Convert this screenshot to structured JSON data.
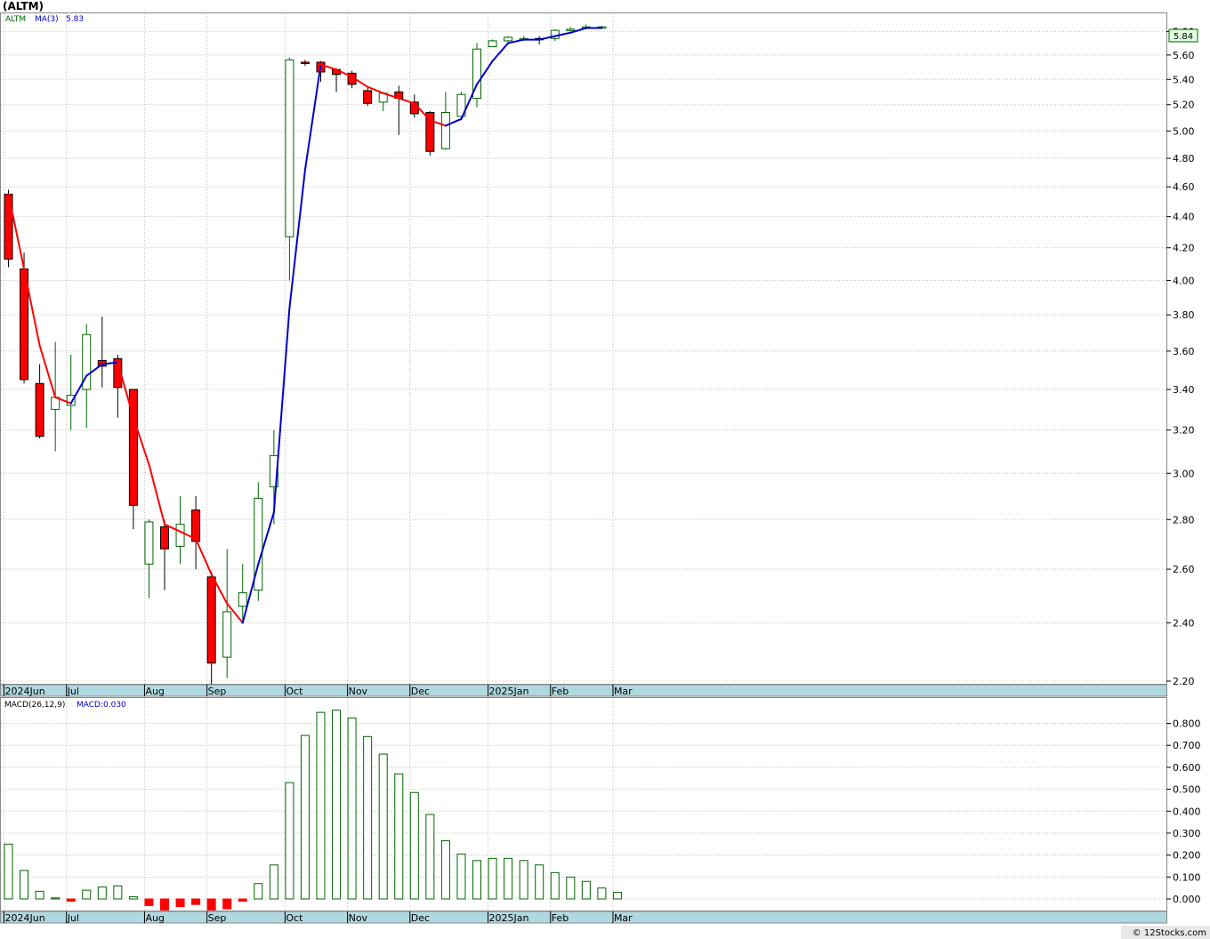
{
  "header": {
    "symbol_title": "(ALTM)",
    "price_legend_symbol": "ALTM",
    "ma_label": "MA(3)",
    "ma_value": "5.83",
    "last_price_tag": "5.84"
  },
  "macd_panel": {
    "params_label": "MACD(26,12,9)",
    "value_label": "MACD:0.030"
  },
  "footer": {
    "watermark": "© 12Stocks.com"
  },
  "colors": {
    "up_candle_outline": "#006400",
    "down_candle_fill": "#ff0000",
    "ma_rising": "#0000cc",
    "ma_falling": "#ff0000",
    "axis_band": "#b0d8e0",
    "grid": "#c0c0c0"
  },
  "chart_data": [
    {
      "type": "candlestick",
      "timeframe": "weekly",
      "y_axis_scale": "log",
      "y_ticks": [
        "2.20",
        "2.40",
        "2.60",
        "2.80",
        "3.00",
        "3.20",
        "3.40",
        "3.60",
        "3.80",
        "4.00",
        "4.20",
        "4.40",
        "4.60",
        "4.80",
        "5.00",
        "5.20",
        "5.40",
        "5.60",
        "5.80"
      ],
      "x_tick_labels": [
        {
          "index": 0,
          "label": "2024Jun"
        },
        {
          "index": 4,
          "label": "Jul"
        },
        {
          "index": 9,
          "label": "Aug"
        },
        {
          "index": 13,
          "label": "Sep"
        },
        {
          "index": 18,
          "label": "Oct"
        },
        {
          "index": 22,
          "label": "Nov"
        },
        {
          "index": 26,
          "label": "Dec"
        },
        {
          "index": 31,
          "label": "2025Jan"
        },
        {
          "index": 35,
          "label": "Feb"
        },
        {
          "index": 39,
          "label": "Mar"
        }
      ],
      "candles": [
        {
          "o": 4.55,
          "h": 4.58,
          "l": 4.08,
          "c": 4.13
        },
        {
          "o": 4.07,
          "h": 4.17,
          "l": 3.43,
          "c": 3.45
        },
        {
          "o": 3.43,
          "h": 3.53,
          "l": 3.16,
          "c": 3.17
        },
        {
          "o": 3.3,
          "h": 3.65,
          "l": 3.1,
          "c": 3.36
        },
        {
          "o": 3.32,
          "h": 3.58,
          "l": 3.2,
          "c": 3.37
        },
        {
          "o": 3.4,
          "h": 3.75,
          "l": 3.21,
          "c": 3.69
        },
        {
          "o": 3.55,
          "h": 3.79,
          "l": 3.41,
          "c": 3.52
        },
        {
          "o": 3.56,
          "h": 3.58,
          "l": 3.26,
          "c": 3.41
        },
        {
          "o": 3.4,
          "h": 3.4,
          "l": 2.76,
          "c": 2.86
        },
        {
          "o": 2.62,
          "h": 2.8,
          "l": 2.49,
          "c": 2.79
        },
        {
          "o": 2.77,
          "h": 2.8,
          "l": 2.52,
          "c": 2.68
        },
        {
          "o": 2.69,
          "h": 2.9,
          "l": 2.62,
          "c": 2.78
        },
        {
          "o": 2.84,
          "h": 2.9,
          "l": 2.6,
          "c": 2.71
        },
        {
          "o": 2.57,
          "h": 2.59,
          "l": 2.19,
          "c": 2.26
        },
        {
          "o": 2.28,
          "h": 2.68,
          "l": 2.21,
          "c": 2.44
        },
        {
          "o": 2.46,
          "h": 2.62,
          "l": 2.4,
          "c": 2.51
        },
        {
          "o": 2.52,
          "h": 2.96,
          "l": 2.48,
          "c": 2.89
        },
        {
          "o": 2.94,
          "h": 3.2,
          "l": 2.78,
          "c": 3.08
        },
        {
          "o": 4.27,
          "h": 5.58,
          "l": 4.0,
          "c": 5.56
        },
        {
          "o": 5.54,
          "h": 5.56,
          "l": 5.51,
          "c": 5.53
        },
        {
          "o": 5.54,
          "h": 5.55,
          "l": 5.38,
          "c": 5.46
        },
        {
          "o": 5.48,
          "h": 5.49,
          "l": 5.3,
          "c": 5.44
        },
        {
          "o": 5.45,
          "h": 5.47,
          "l": 5.33,
          "c": 5.36
        },
        {
          "o": 5.31,
          "h": 5.33,
          "l": 5.19,
          "c": 5.21
        },
        {
          "o": 5.22,
          "h": 5.3,
          "l": 5.15,
          "c": 5.29
        },
        {
          "o": 5.3,
          "h": 5.35,
          "l": 4.97,
          "c": 5.25
        },
        {
          "o": 5.22,
          "h": 5.28,
          "l": 5.1,
          "c": 5.13
        },
        {
          "o": 5.14,
          "h": 5.15,
          "l": 4.82,
          "c": 4.85
        },
        {
          "o": 4.87,
          "h": 5.3,
          "l": 4.86,
          "c": 5.14
        },
        {
          "o": 5.11,
          "h": 5.3,
          "l": 5.08,
          "c": 5.28
        },
        {
          "o": 5.25,
          "h": 5.7,
          "l": 5.18,
          "c": 5.65
        },
        {
          "o": 5.67,
          "h": 5.73,
          "l": 5.67,
          "c": 5.72
        },
        {
          "o": 5.72,
          "h": 5.76,
          "l": 5.7,
          "c": 5.75
        },
        {
          "o": 5.74,
          "h": 5.76,
          "l": 5.72,
          "c": 5.74
        },
        {
          "o": 5.74,
          "h": 5.76,
          "l": 5.69,
          "c": 5.73
        },
        {
          "o": 5.74,
          "h": 5.82,
          "l": 5.72,
          "c": 5.81
        },
        {
          "o": 5.82,
          "h": 5.84,
          "l": 5.81,
          "c": 5.82
        },
        {
          "o": 5.83,
          "h": 5.86,
          "l": 5.82,
          "c": 5.84
        },
        {
          "o": 5.84,
          "h": 5.85,
          "l": 5.83,
          "c": 5.84
        }
      ],
      "ma3": [
        4.55,
        4.07,
        3.63,
        3.36,
        3.33,
        3.47,
        3.53,
        3.54,
        3.26,
        3.04,
        2.78,
        2.75,
        2.72,
        2.58,
        2.47,
        2.4,
        2.62,
        2.83,
        3.84,
        4.72,
        5.52,
        5.48,
        5.42,
        5.34,
        5.29,
        5.25,
        5.21,
        5.08,
        5.04,
        5.09,
        5.36,
        5.55,
        5.7,
        5.73,
        5.73,
        5.76,
        5.79,
        5.83,
        5.83
      ]
    },
    {
      "type": "bar",
      "title": "MACD(26,12,9)",
      "y_ticks": [
        "0.000",
        "0.100",
        "0.200",
        "0.300",
        "0.400",
        "0.500",
        "0.600",
        "0.700",
        "0.800"
      ],
      "ylim": [
        -0.05,
        0.88
      ],
      "values": [
        0.25,
        0.13,
        0.035,
        0.005,
        -0.01,
        0.04,
        0.055,
        0.06,
        0.01,
        -0.03,
        -0.05,
        -0.035,
        -0.025,
        -0.05,
        -0.045,
        -0.01,
        0.07,
        0.155,
        0.53,
        0.745,
        0.85,
        0.86,
        0.825,
        0.74,
        0.66,
        0.57,
        0.485,
        0.385,
        0.265,
        0.205,
        0.175,
        0.185,
        0.185,
        0.175,
        0.155,
        0.12,
        0.1,
        0.08,
        0.05,
        0.03
      ]
    }
  ]
}
